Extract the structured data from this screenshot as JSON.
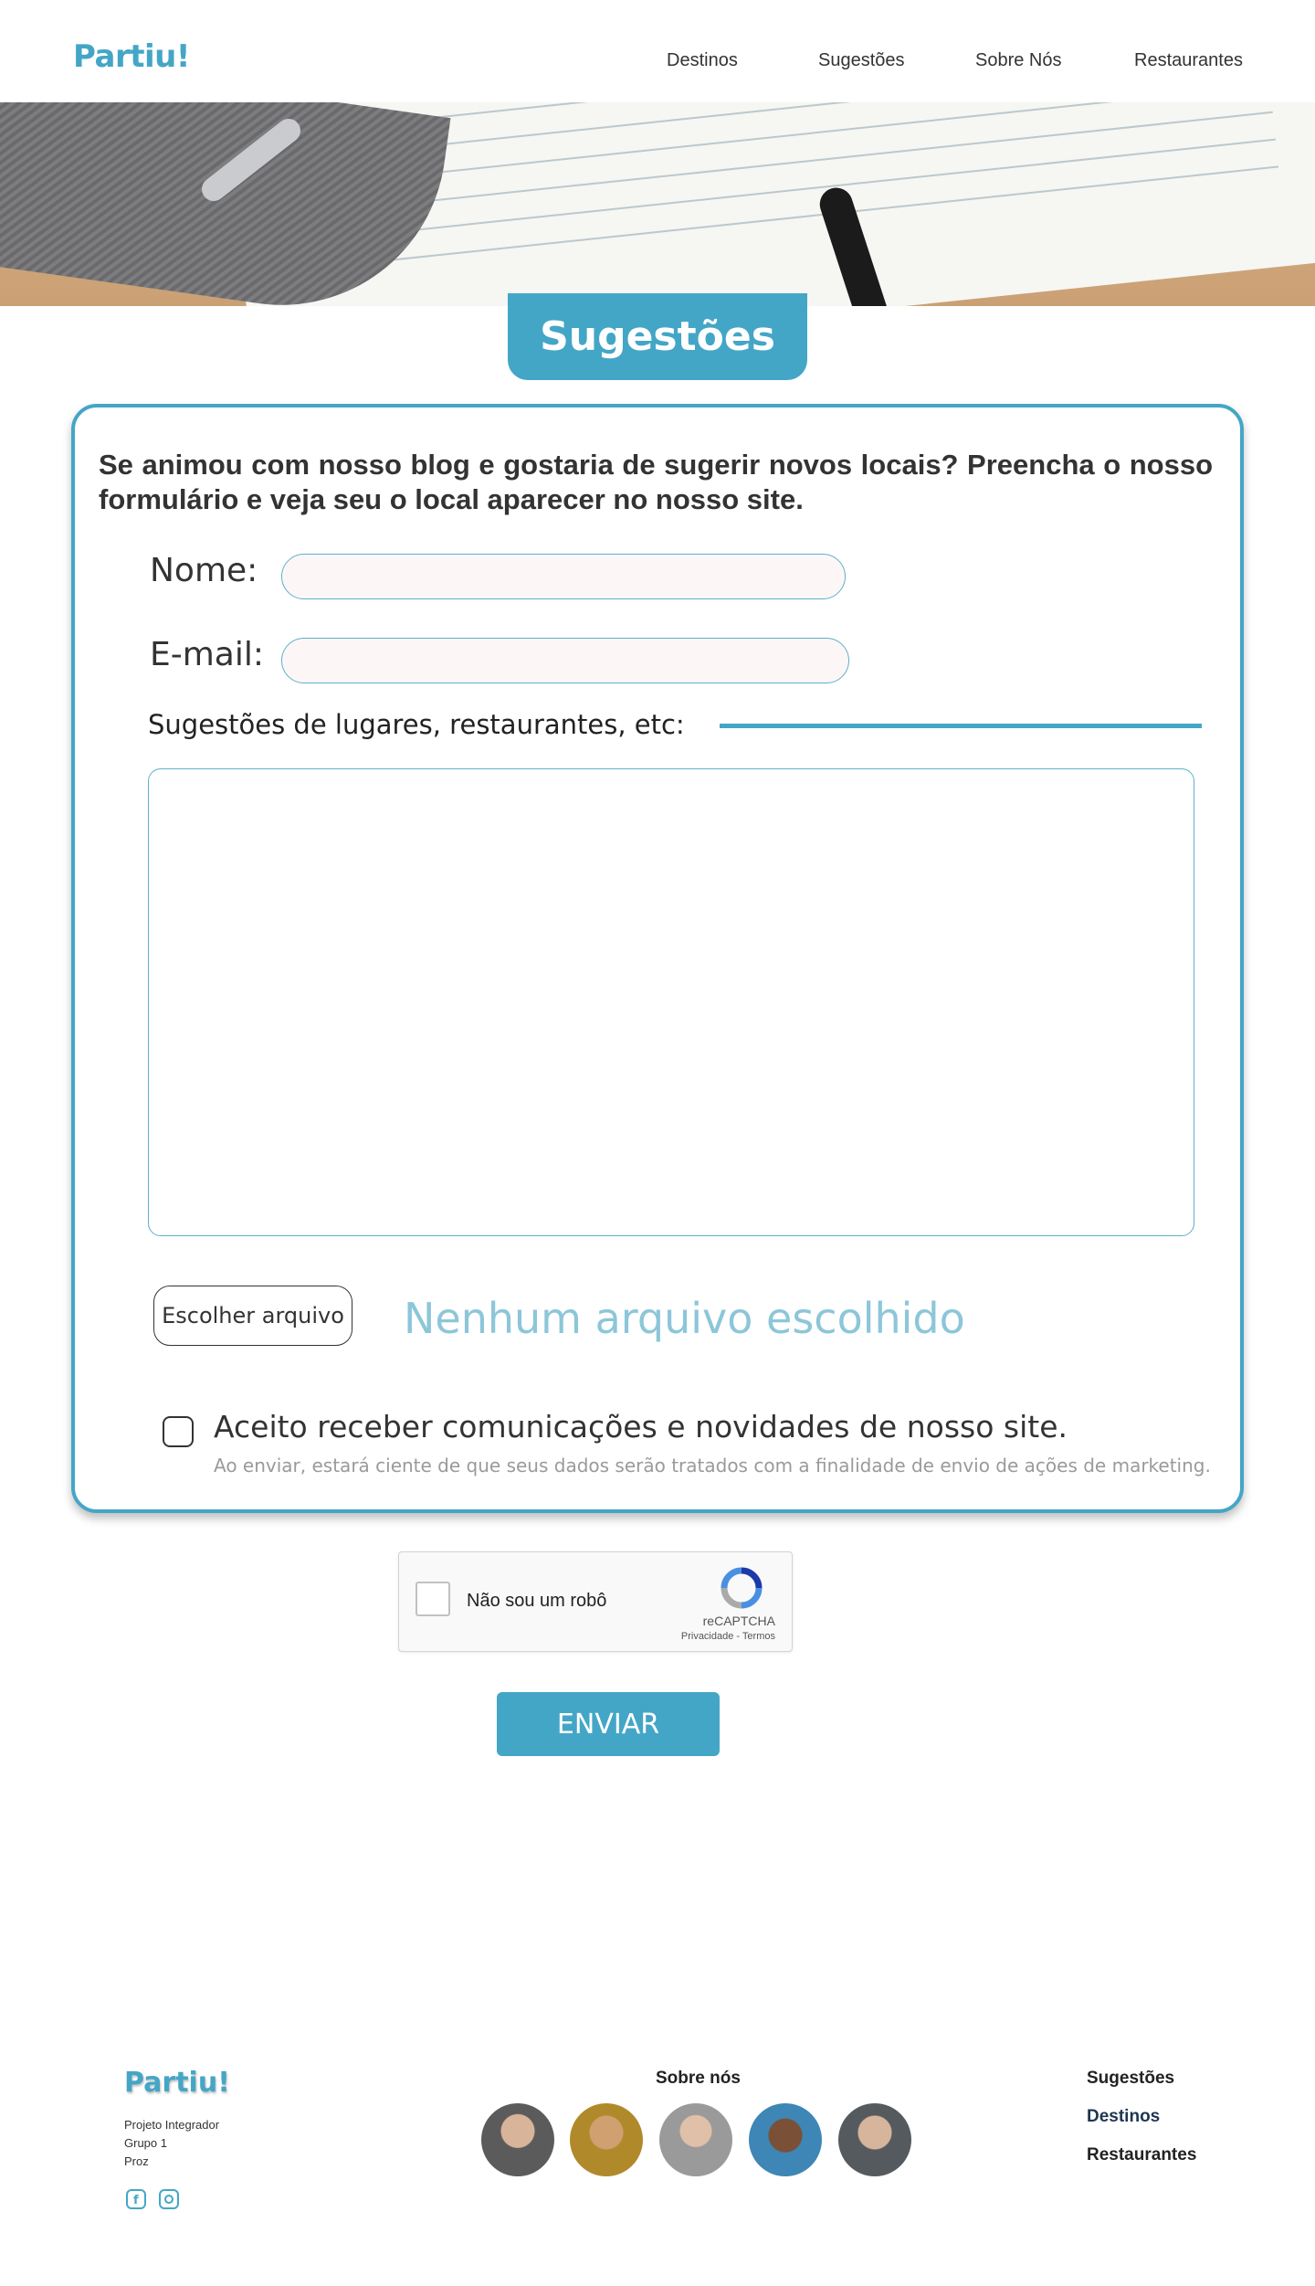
{
  "header": {
    "logo": "Partiu!",
    "nav": [
      "Destinos",
      "Sugestões",
      "Sobre Nós",
      "Restaurantes"
    ]
  },
  "page": {
    "title": "Sugestões"
  },
  "form": {
    "intro": "Se animou com nosso blog e gostaria de sugerir novos locais? Preencha o nosso formulário e veja seu o local aparecer no nosso site.",
    "name_label": "Nome:",
    "email_label": "E-mail:",
    "suggestions_label": "Sugestões de  lugares, restaurantes, etc:",
    "file_button": "Escolher arquivo",
    "file_status": "Nenhum arquivo escolhido",
    "consent": "Aceito receber comunicações e novidades de nosso site.",
    "consent_note": "Ao enviar, estará ciente de que seus dados serão tratados com a finalidade de envio de ações de marketing."
  },
  "recaptcha": {
    "label": "Não sou um robô",
    "brand": "reCAPTCHA",
    "links": "Privacidade - Termos"
  },
  "submit_label": "ENVIAR",
  "footer": {
    "logo": "Partiu!",
    "meta": [
      "Projeto Integrador",
      "Grupo 1",
      "Proz"
    ],
    "about_title": "Sobre nós",
    "links": [
      "Sugestões",
      "Destinos",
      "Restaurantes"
    ]
  },
  "colors": {
    "accent": "#44a6c6",
    "field_bg": "#fcf7f6"
  }
}
